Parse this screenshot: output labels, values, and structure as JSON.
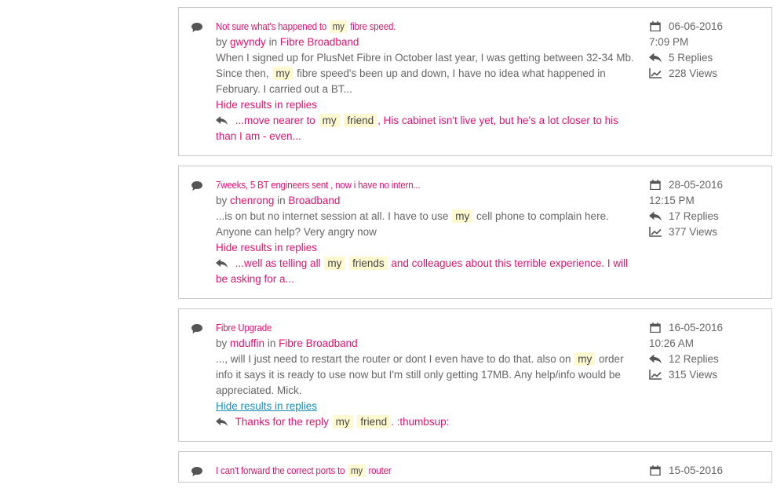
{
  "results": [
    {
      "title_parts": [
        "Not sure what's happened to",
        "my",
        "fibre speed."
      ],
      "by_label": "by",
      "author": "gwyndy",
      "in_label": "in",
      "board": "Fibre Broadband",
      "snippet_parts": [
        "When I signed up for PlusNet Fibre in October last year, I was getting between 32-34 Mb. Since then,",
        "my",
        "fibre speed's been up and down, I have no idea what happened in February. I carried out a BT..."
      ],
      "hide_label": "Hide results in replies",
      "reply_parts": [
        "...move nearer to",
        "my",
        "friend",
        ", His cabinet isn't live yet, but he's a lot closer to his than I am - even..."
      ],
      "date": "06-06-2016",
      "time": "7:09 PM",
      "replies": "5 Replies",
      "views": "228 Views"
    },
    {
      "title_parts": [
        "7weeks, 5 BT engineers sent , now i have no intern..."
      ],
      "by_label": "by",
      "author": "chenrong",
      "in_label": "in",
      "board": "Broadband",
      "snippet_parts": [
        "...is on but no internet session at all. I have to use",
        "my",
        "cell phone to complain here. Anyone can help? Very angry now"
      ],
      "hide_label": "Hide results in replies",
      "reply_parts": [
        "...well as telling all",
        "my",
        "friends",
        "and colleagues about this terrible experience. I will be asking for a..."
      ],
      "date": "28-05-2016",
      "time": "12:15 PM",
      "replies": "17 Replies",
      "views": "377 Views"
    },
    {
      "title_parts": [
        "Fibre Upgrade"
      ],
      "by_label": "by",
      "author": "mduffin",
      "in_label": "in",
      "board": "Fibre Broadband",
      "snippet_parts": [
        "..., will I just need to restart the router or dont I even have to do that. also on",
        "my",
        "order info it says it is ready to use now but I'm still only getting 17MB. Any help/info would be appreciated. Mick."
      ],
      "hide_label": "Hide results in replies",
      "reply_parts": [
        "Thanks for the reply",
        "my",
        "friend",
        ". :thumbsup:"
      ],
      "date": "16-05-2016",
      "time": "10:26 AM",
      "replies": "12 Replies",
      "views": "315 Views"
    },
    {
      "title_parts": [
        "I can't forward the correct ports to",
        "my",
        "router"
      ],
      "date": "15-05-2016"
    }
  ],
  "colors": {
    "accent": "#d9166f",
    "focus_link": "#1a8fb8",
    "highlight": "#fff9d2",
    "border": "#c8c8c8"
  },
  "icons": {
    "thread": "speech-bubble-icon",
    "reply": "reply-arrow-icon",
    "date": "calendar-icon",
    "replies": "reply-arrow-icon",
    "views": "line-chart-icon"
  }
}
